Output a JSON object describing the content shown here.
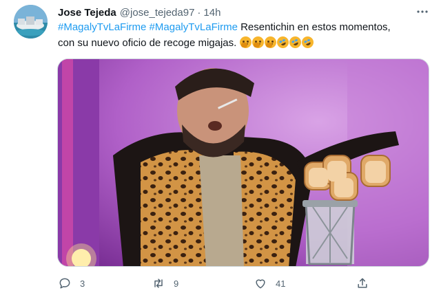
{
  "tweet": {
    "author_name": "Jose Tejeda",
    "author_handle": "@jose_tejeda97",
    "separator": "·",
    "time": "14h",
    "text_line1_hashtag1": "#MagalyTvLaFirme",
    "text_line1_hashtag2": "#MagalyTvLaFirme",
    "text_line1_rest": " Resentichin en estos momentos,",
    "text_line2": "con su nuevo oficio de recoge migajas. ",
    "emojis": [
      "shushing-face-emoji",
      "shushing-face-emoji",
      "shushing-face-emoji",
      "rofl-emoji",
      "rofl-emoji",
      "rofl-emoji"
    ]
  },
  "actions": {
    "reply_count": "3",
    "retweet_count": "9",
    "like_count": "41"
  },
  "colors": {
    "link": "#1d9bf0",
    "secondary_text": "#536471",
    "text": "#0f1419",
    "border": "#cfd9de",
    "studio_purple": "#b060c8",
    "jacket_leopard": "#c78a3a"
  },
  "icons": {
    "more": "more-dots-icon",
    "reply": "reply-icon",
    "retweet": "retweet-icon",
    "like": "heart-icon",
    "share": "share-icon"
  }
}
